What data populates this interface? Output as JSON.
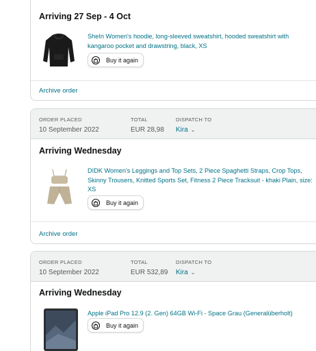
{
  "orders": [
    {
      "arriving": "Arriving 27 Sep - 4 Oct",
      "product_title": "SheIn Women's hoodie, long-sleeved sweatshirt, hooded sweatshirt with kangaroo pocket and drawstring, black, XS",
      "buy_again_label": "Buy it again",
      "archive_label": "Archive order"
    },
    {
      "order_placed_label": "ORDER PLACED",
      "order_placed_value": "10 September 2022",
      "total_label": "TOTAL",
      "total_value": "EUR 28,98",
      "dispatch_label": "DISPATCH TO",
      "dispatch_value": "Kira",
      "arriving": "Arriving Wednesday",
      "product_title": "DIDK Women's Leggings and Top Sets, 2 Piece Spaghetti Straps, Crop Tops, Skinny Trousers, Knitted Sports Set, Fitness 2 Piece Tracksuit - khaki Plain, size: XS",
      "buy_again_label": "Buy it again",
      "archive_label": "Archive order"
    },
    {
      "order_placed_label": "ORDER PLACED",
      "order_placed_value": "10 September 2022",
      "total_label": "TOTAL",
      "total_value": "EUR 532,89",
      "dispatch_label": "DISPATCH TO",
      "dispatch_value": "Kira",
      "arriving": "Arriving Wednesday",
      "product_title": "Apple iPad Pro 12.9 (2. Gen) 64GB Wi-Fi - Space Grau (Generalüberholt)",
      "buy_again_label": "Buy it again"
    }
  ],
  "icons": {
    "buy_again": "reorder-icon",
    "dispatch_dropdown": "chevron-down-icon"
  }
}
